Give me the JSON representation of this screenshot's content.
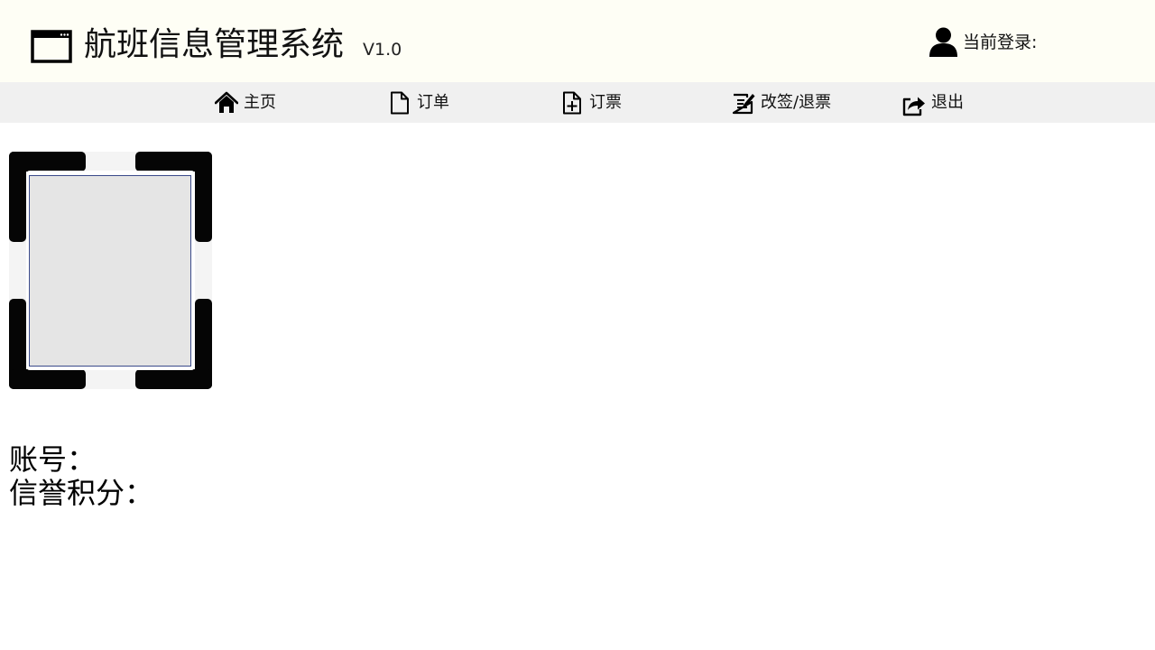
{
  "header": {
    "title": "航班信息管理系统",
    "version": "V1.0",
    "login_label": "当前登录:",
    "app_icon": "window-icon",
    "user_icon": "user-icon",
    "background_color": "#fefef5"
  },
  "nav": {
    "background_color": "#f0f0f0",
    "items": [
      {
        "label": "主页",
        "icon": "home-icon"
      },
      {
        "label": "订单",
        "icon": "document-icon"
      },
      {
        "label": "订票",
        "icon": "add-document-icon"
      },
      {
        "label": "改签/退票",
        "icon": "edit-document-icon"
      },
      {
        "label": "退出",
        "icon": "share-exit-icon"
      }
    ]
  },
  "profile": {
    "account_label": "账号：",
    "credit_label": "信誉积分："
  }
}
